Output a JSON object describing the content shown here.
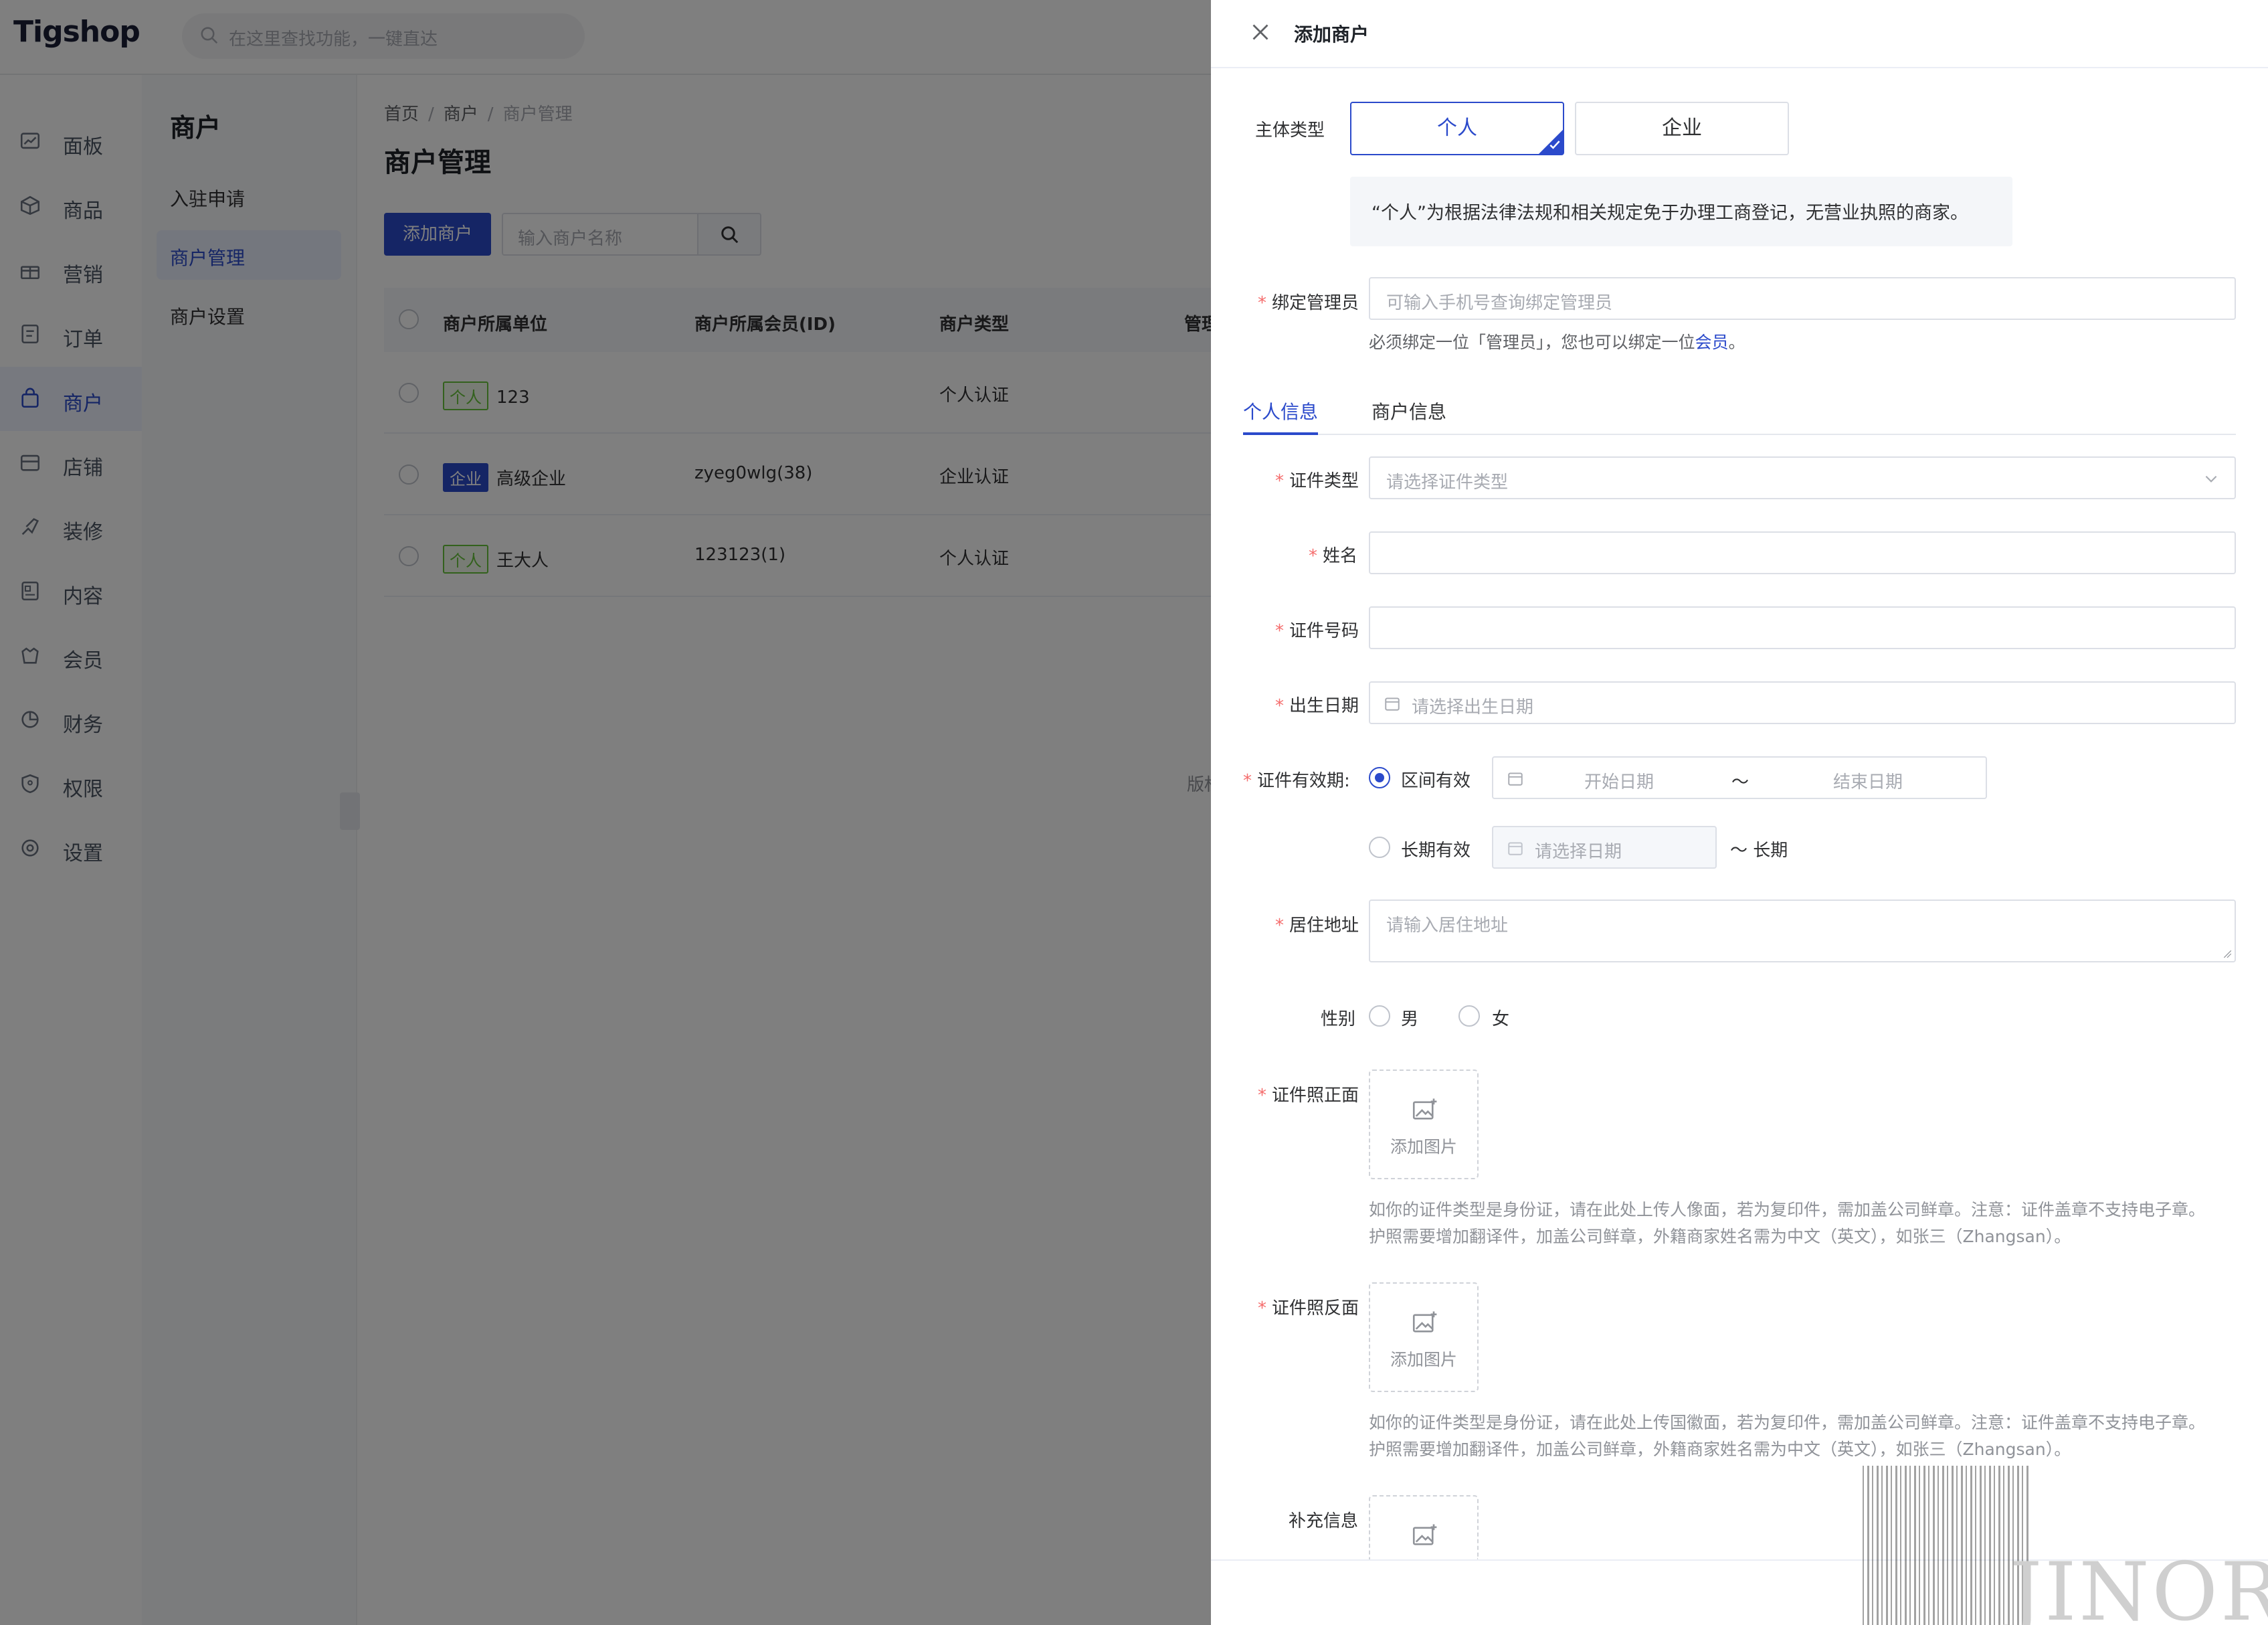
{
  "app": {
    "logo": "Tigshop",
    "search_placeholder": "在这里查找功能，一键直达"
  },
  "sidebar": {
    "items": [
      {
        "label": "面板",
        "icon": "chart-icon"
      },
      {
        "label": "商品",
        "icon": "box-icon"
      },
      {
        "label": "营销",
        "icon": "gift-icon"
      },
      {
        "label": "订单",
        "icon": "order-icon"
      },
      {
        "label": "商户",
        "icon": "shop-bag-icon"
      },
      {
        "label": "店铺",
        "icon": "store-icon"
      },
      {
        "label": "装修",
        "icon": "brush-icon"
      },
      {
        "label": "内容",
        "icon": "content-icon"
      },
      {
        "label": "会员",
        "icon": "member-icon"
      },
      {
        "label": "财务",
        "icon": "finance-icon"
      },
      {
        "label": "权限",
        "icon": "shield-icon"
      },
      {
        "label": "设置",
        "icon": "gear-icon"
      }
    ],
    "active": "商户"
  },
  "submenu": {
    "title": "商户",
    "items": [
      "入驻申请",
      "商户管理",
      "商户设置"
    ],
    "active": "商户管理"
  },
  "breadcrumb": [
    "首页",
    "商户",
    "商户管理"
  ],
  "page": {
    "title": "商户管理",
    "add_button": "添加商户",
    "keyword_placeholder": "输入商户名称"
  },
  "table": {
    "columns": [
      "商户所属单位",
      "商户所属会员(ID)",
      "商户类型",
      "管理"
    ],
    "rows": [
      {
        "tag": "个人",
        "tag_type": "personal",
        "name": "123",
        "member": "",
        "type": "个人认证"
      },
      {
        "tag": "企业",
        "tag_type": "company",
        "name": "高级企业",
        "member": "zyeg0wlg(38)",
        "type": "企业认证"
      },
      {
        "tag": "个人",
        "tag_type": "personal",
        "name": "王大人",
        "member": "123123(1)",
        "type": "个人认证"
      }
    ]
  },
  "copyright": "版权",
  "drawer": {
    "title": "添加商户",
    "subject_label": "主体类型",
    "subject_options": [
      "个人",
      "企业"
    ],
    "subject_selected": "个人",
    "notice": "“个人”为根据法律法规和相关规定免于办理工商登记，无营业执照的商家。",
    "admin_label": "绑定管理员",
    "admin_placeholder": "可输入手机号查询绑定管理员",
    "admin_hint_pre": "必须绑定一位「管理员」，您也可以绑定一位",
    "admin_hint_link": "会员",
    "admin_hint_post": "。",
    "tabs": [
      "个人信息",
      "商户信息"
    ],
    "tab_active": "个人信息",
    "id_type_label": "证件类型",
    "id_type_placeholder": "请选择证件类型",
    "name_label": "姓名",
    "id_no_label": "证件号码",
    "birth_label": "出生日期",
    "birth_placeholder": "请选择出生日期",
    "validity_label": "证件有效期:",
    "validity_range": "区间有效",
    "validity_range_selected": true,
    "start_placeholder": "开始日期",
    "range_sep": "〜",
    "end_placeholder": "结束日期",
    "validity_long": "长期有效",
    "long_placeholder": "请选择日期",
    "long_suffix": "〜 长期",
    "address_label": "居住地址",
    "address_placeholder": "请输入居住地址",
    "gender_label": "性别",
    "gender_options": [
      "男",
      "女"
    ],
    "front_label": "证件照正面",
    "upload_text": "添加图片",
    "front_help_1": "如你的证件类型是身份证，请在此处上传人像面，若为复印件，需加盖公司鲜章。注意：证件盖章不支持电子章。",
    "front_help_2": "护照需要增加翻译件，加盖公司鲜章，外籍商家姓名需为中文（英文），如张三（Zhangsan）。",
    "back_label": "证件照反面",
    "back_help_1": "如你的证件类型是身份证，请在此处上传国徽面，若为复印件，需加盖公司鲜章。注意：证件盖章不支持电子章。",
    "back_help_2": "护照需要增加翻译件，加盖公司鲜章，外籍商家姓名需为中文（英文），如张三（Zhangsan）。",
    "extra_label": "补充信息"
  },
  "watermark": {
    "text": "JINOR"
  },
  "colors": {
    "primary": "#2b4acb",
    "required": "#f56c6c",
    "tag_personal": "#67c23a"
  }
}
